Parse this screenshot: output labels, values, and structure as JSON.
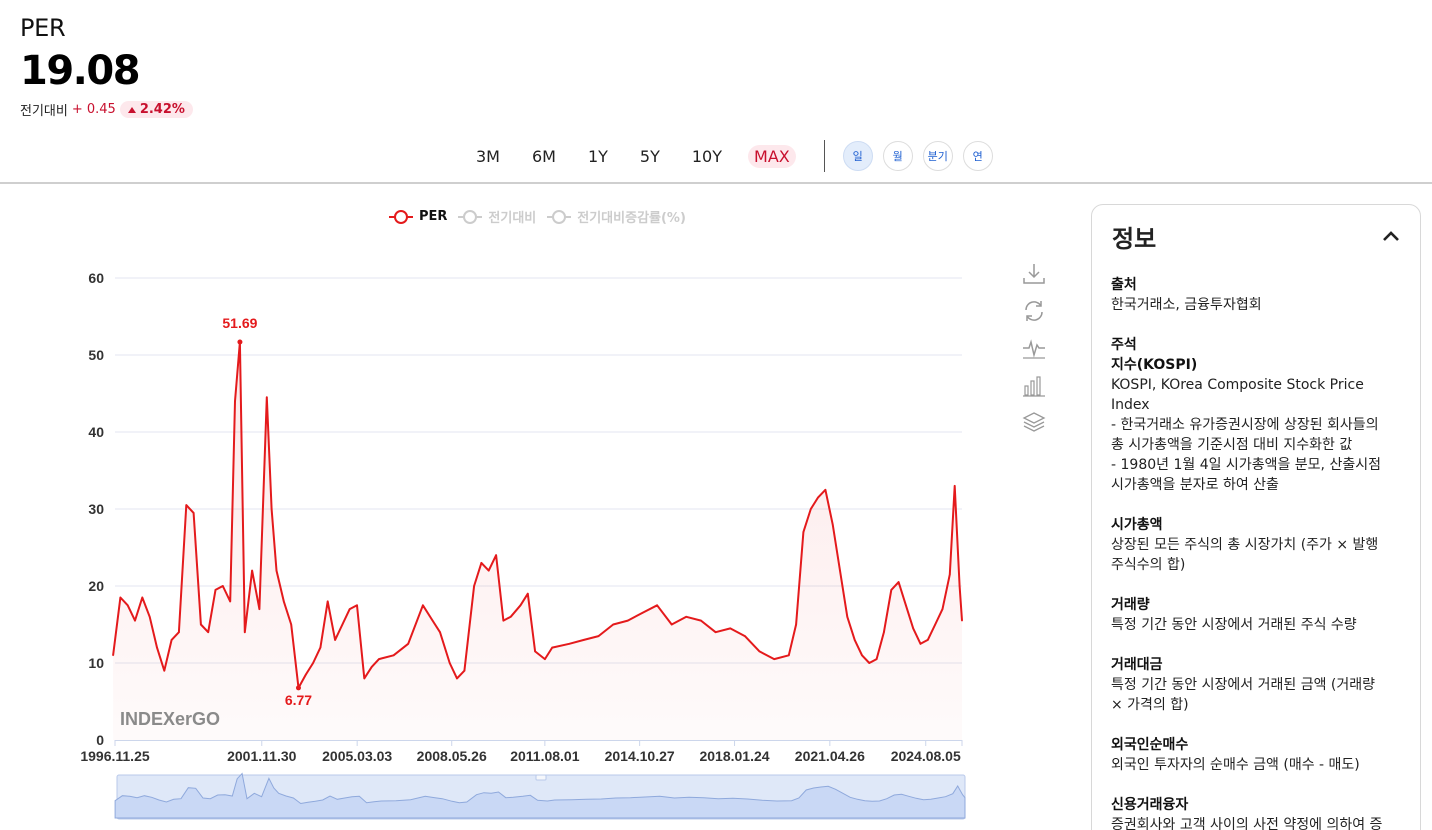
{
  "header": {
    "title": "PER",
    "value": "19.08",
    "change_label": "전기대비",
    "change_abs": "+ 0.45",
    "change_pct": "2.42%"
  },
  "ranges": [
    "3M",
    "6M",
    "1Y",
    "5Y",
    "10Y",
    "MAX"
  ],
  "active_range": "MAX",
  "periods": [
    "일",
    "월",
    "분기",
    "연"
  ],
  "active_period": "일",
  "legend": [
    {
      "label": "PER",
      "active": true
    },
    {
      "label": "전기대비",
      "active": false
    },
    {
      "label": "전기대비증감률(%)",
      "active": false
    }
  ],
  "toolbar_icons": [
    "download-icon",
    "refresh-icon",
    "line-chart-icon",
    "bar-chart-icon",
    "layers-icon"
  ],
  "watermark": "INDEXerGO",
  "colors": {
    "line": "#e41a1c",
    "up": "#c8102e",
    "accent_blue": "#1e5fd1",
    "navigator": "#c9d8f5"
  },
  "chart_data": {
    "type": "line",
    "title": "",
    "xlabel": "",
    "ylabel": "",
    "ylim": [
      0,
      60
    ],
    "yticks": [
      0,
      10,
      20,
      30,
      40,
      50,
      60
    ],
    "xtick_labels": [
      "1996.11.25",
      "2001.11.30",
      "2005.03.03",
      "2008.05.26",
      "2011.08.01",
      "2014.10.27",
      "2018.01.24",
      "2021.04.26",
      "2024.08.05"
    ],
    "annotations": [
      {
        "label": "51.69",
        "x": "2001.03",
        "y": 51.69
      },
      {
        "label": "6.77",
        "x": "2003.03",
        "y": 6.77
      }
    ],
    "series": [
      {
        "name": "PER",
        "x": [
          "1996.11",
          "1997.02",
          "1997.05",
          "1997.08",
          "1997.11",
          "1998.02",
          "1998.05",
          "1998.08",
          "1998.11",
          "1999.02",
          "1999.05",
          "1999.08",
          "1999.11",
          "2000.02",
          "2000.05",
          "2000.08",
          "2000.11",
          "2001.01",
          "2001.03",
          "2001.05",
          "2001.08",
          "2001.11",
          "2002.02",
          "2002.04",
          "2002.06",
          "2002.09",
          "2002.12",
          "2003.03",
          "2003.06",
          "2003.09",
          "2003.12",
          "2004.03",
          "2004.06",
          "2004.09",
          "2004.12",
          "2005.03",
          "2005.06",
          "2005.09",
          "2005.12",
          "2006.06",
          "2006.12",
          "2007.06",
          "2007.10",
          "2008.01",
          "2008.05",
          "2008.08",
          "2008.11",
          "2009.03",
          "2009.06",
          "2009.09",
          "2009.12",
          "2010.03",
          "2010.06",
          "2010.10",
          "2011.01",
          "2011.04",
          "2011.08",
          "2011.11",
          "2012.06",
          "2012.12",
          "2013.06",
          "2013.12",
          "2014.06",
          "2014.12",
          "2015.06",
          "2015.12",
          "2016.06",
          "2016.12",
          "2017.06",
          "2017.12",
          "2018.06",
          "2018.12",
          "2019.06",
          "2019.12",
          "2020.03",
          "2020.06",
          "2020.09",
          "2020.12",
          "2021.03",
          "2021.06",
          "2021.09",
          "2021.12",
          "2022.03",
          "2022.06",
          "2022.09",
          "2022.12",
          "2023.03",
          "2023.06",
          "2023.09",
          "2023.12",
          "2024.03",
          "2024.06",
          "2024.09",
          "2024.12",
          "2025.03",
          "2025.06",
          "2025.08",
          "2025.10",
          "2025.11"
        ],
        "values": [
          11.0,
          18.5,
          17.5,
          15.5,
          18.5,
          16.0,
          12.0,
          9.0,
          13.0,
          14.0,
          30.5,
          29.5,
          15.0,
          14.0,
          19.5,
          20.0,
          18.0,
          44.0,
          51.69,
          14.0,
          22.0,
          17.0,
          44.5,
          30.0,
          22.0,
          18.0,
          15.0,
          6.77,
          8.5,
          10.0,
          12.0,
          18.0,
          13.0,
          15.0,
          17.0,
          17.5,
          8.0,
          9.5,
          10.5,
          11.0,
          12.5,
          17.5,
          15.5,
          14.0,
          10.0,
          8.0,
          9.0,
          20.0,
          23.0,
          22.0,
          24.0,
          15.5,
          16.0,
          17.5,
          19.0,
          11.5,
          10.5,
          12.0,
          12.5,
          13.0,
          13.5,
          15.0,
          15.5,
          16.5,
          17.5,
          15.0,
          16.0,
          15.5,
          14.0,
          14.5,
          13.5,
          11.5,
          10.5,
          11.0,
          15.0,
          27.0,
          30.0,
          31.5,
          32.5,
          28.0,
          22.0,
          16.0,
          13.0,
          11.0,
          10.0,
          10.5,
          14.0,
          19.5,
          20.5,
          17.5,
          14.5,
          12.5,
          13.0,
          15.0,
          17.0,
          21.5,
          33.0,
          20.0,
          15.5
        ]
      }
    ]
  },
  "info": {
    "title": "정보",
    "items": [
      {
        "key": "출처",
        "value": "한국거래소, 금융투자협회"
      },
      {
        "key": "주석",
        "value": ""
      },
      {
        "key": "지수(KOSPI)",
        "value": "KOSPI, KOrea Composite Stock Price Index\n- 한국거래소 유가증권시장에 상장된 회사들의\n총 시가총액을 기준시점 대비 지수화한 값\n- 1980년 1월 4일 시가총액을 분모, 산출시점\n시가총액을 분자로 하여 산출"
      },
      {
        "key": "시가총액",
        "value": "상장된 모든 주식의 총 시장가치 (주가 × 발행\n주식수의 합)"
      },
      {
        "key": "거래량",
        "value": "특정 기간 동안 시장에서 거래된 주식 수량"
      },
      {
        "key": "거래대금",
        "value": "특정 기간 동안 시장에서 거래된 금액 (거래량\n× 가격의 합)"
      },
      {
        "key": "외국인순매수",
        "value": "외국인 투자자의 순매수 금액 (매수 - 매도)"
      },
      {
        "key": "신용거래융자",
        "value": "증권회사와 고객 사이의 사전 약정에 의하여 증\n권회사가 고객에게 주식 매수 자금을 대여해 주"
      }
    ]
  }
}
